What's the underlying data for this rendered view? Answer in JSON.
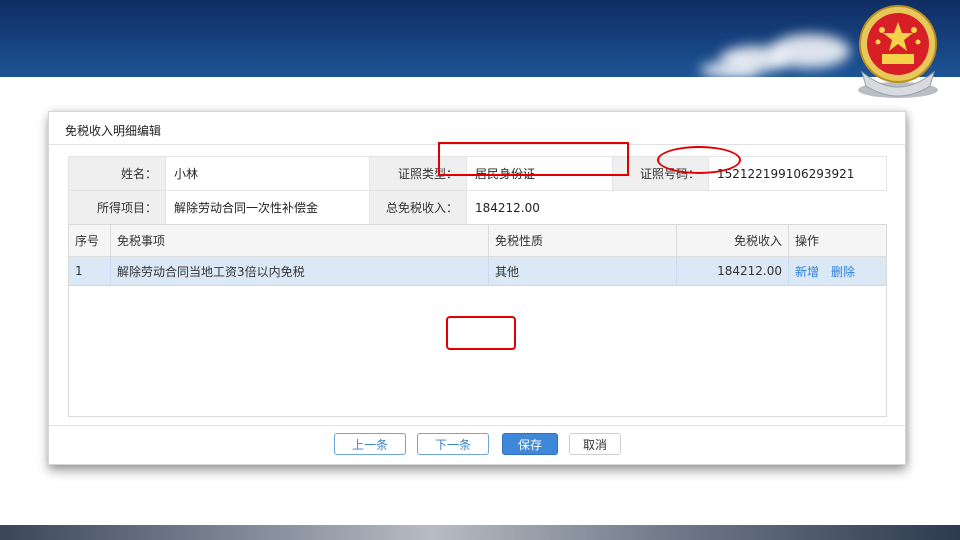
{
  "dialog": {
    "title": "免税收入明细编辑"
  },
  "info": {
    "name_label": "姓名：",
    "name_value": "小林",
    "id_type_label": "证照类型：",
    "id_type_value": "居民身份证",
    "id_no_label": "证照号码：",
    "id_no_value": "152122199106293921",
    "income_item_label": "所得项目：",
    "income_item_value": "解除劳动合同一次性补偿金",
    "total_label": "总免税收入：",
    "total_value": "184212.00"
  },
  "table": {
    "headers": [
      "序号",
      "免税事项",
      "免税性质",
      "免税收入",
      "操作"
    ],
    "rows": [
      {
        "index": "1",
        "item": "解除劳动合同当地工资3倍以内免税",
        "nature": "其他",
        "income": "184212.00",
        "add": "新增",
        "delete": "删除"
      }
    ]
  },
  "buttons": {
    "prev": "上一条",
    "next": "下一条",
    "save": "保存",
    "cancel": "取消"
  },
  "colors": {
    "banner": "#16427f",
    "primary": "#3f88d9",
    "highlight": "#e00000",
    "link": "#2f7fd6"
  },
  "icons": {
    "emblem": "national-emblem-icon"
  }
}
